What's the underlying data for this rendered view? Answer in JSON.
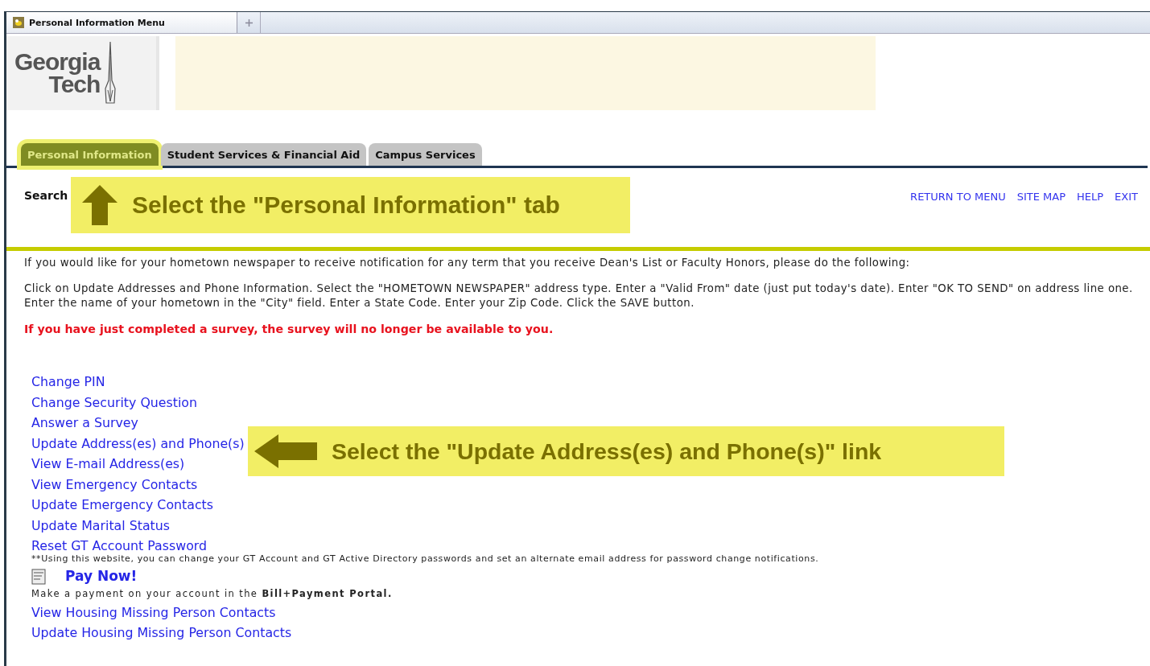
{
  "browser_tab": {
    "title": "Personal Information Menu"
  },
  "logo": {
    "line1": "Georgia",
    "line2": "Tech"
  },
  "tabs": [
    {
      "label": "Personal Information",
      "selected": true
    },
    {
      "label": "Student Services & Financial Aid",
      "selected": false
    },
    {
      "label": "Campus Services",
      "selected": false
    }
  ],
  "search": {
    "label": "Search"
  },
  "top_links": [
    "RETURN TO MENU",
    "SITE MAP",
    "HELP",
    "EXIT"
  ],
  "intro": [
    "If you would like for your hometown newspaper to receive notification for any term that you receive Dean's List or Faculty Honors, please do the following:",
    "Click on Update Addresses and Phone Information. Select the \"HOMETOWN NEWSPAPER\" address type. Enter a \"Valid From\" date (just put today's date). Enter \"OK TO SEND\" on address line one. Enter the name of your hometown in the \"City\" field. Enter a State Code. Enter your Zip Code. Click the SAVE button."
  ],
  "warning": "If you have just completed a survey, the survey will no longer be available to you.",
  "menu": [
    {
      "kind": "link",
      "text": "Change PIN"
    },
    {
      "kind": "link",
      "text": "Change Security Question"
    },
    {
      "kind": "link",
      "text": "Answer a Survey"
    },
    {
      "kind": "link",
      "text": "Update Address(es) and Phone(s)"
    },
    {
      "kind": "link",
      "text": "View E-mail Address(es)"
    },
    {
      "kind": "link",
      "text": "View Emergency Contacts"
    },
    {
      "kind": "link",
      "text": "Update Emergency Contacts"
    },
    {
      "kind": "link",
      "text": "Update Marital Status"
    },
    {
      "kind": "link",
      "text": "Reset GT Account Password"
    },
    {
      "kind": "note",
      "text": "**Using this website, you can change your GT Account and GT Active Directory passwords and set an alternate email address for password change notifications."
    },
    {
      "kind": "pay",
      "text": "Pay Now!"
    },
    {
      "kind": "note",
      "text": "Make a payment on your account in the **Bill+Payment Portal.**"
    },
    {
      "kind": "link",
      "text": "View Housing Missing Person Contacts"
    },
    {
      "kind": "link",
      "text": "Update Housing Missing Person Contacts"
    }
  ],
  "callouts": [
    {
      "kind": "up",
      "text": "Select the \"Personal Information\" tab"
    },
    {
      "kind": "left",
      "text": "Select the \"Update Address(es) and Phone(s)\" link"
    }
  ]
}
